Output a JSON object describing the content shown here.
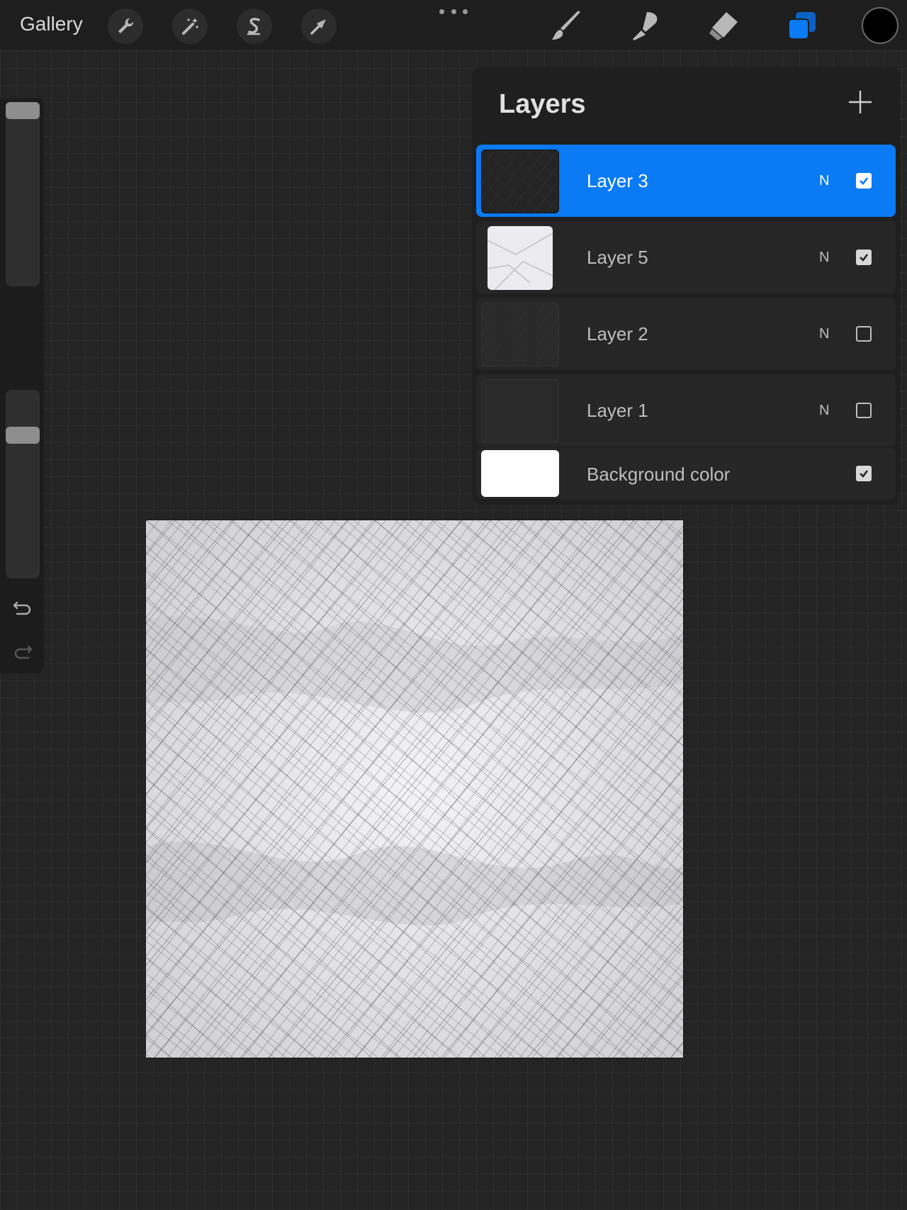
{
  "topbar": {
    "gallery_label": "Gallery",
    "left_tools": [
      "wrench-icon",
      "magic-wand-icon",
      "selection-s-icon",
      "transform-arrow-icon"
    ],
    "right_tools": [
      "brush-icon",
      "smudge-icon",
      "eraser-icon",
      "layers-icon"
    ],
    "active_tool": "layers-icon",
    "current_color": "#000000",
    "accent_color": "#0a7af5"
  },
  "sidebar": {
    "brush_size_level": 0.0,
    "opacity_level": 0.3,
    "icons": [
      "modify-square-icon",
      "undo-icon",
      "redo-icon"
    ]
  },
  "layers_panel": {
    "title": "Layers",
    "add_icon": "plus-icon",
    "layers": [
      {
        "name": "Layer 3",
        "blend": "N",
        "visible": true,
        "selected": true
      },
      {
        "name": "Layer 5",
        "blend": "N",
        "visible": true,
        "selected": false
      },
      {
        "name": "Layer 2",
        "blend": "N",
        "visible": false,
        "selected": false
      },
      {
        "name": "Layer 1",
        "blend": "N",
        "visible": false,
        "selected": false
      }
    ],
    "background": {
      "name": "Background color",
      "color": "#ffffff",
      "visible": true
    }
  }
}
